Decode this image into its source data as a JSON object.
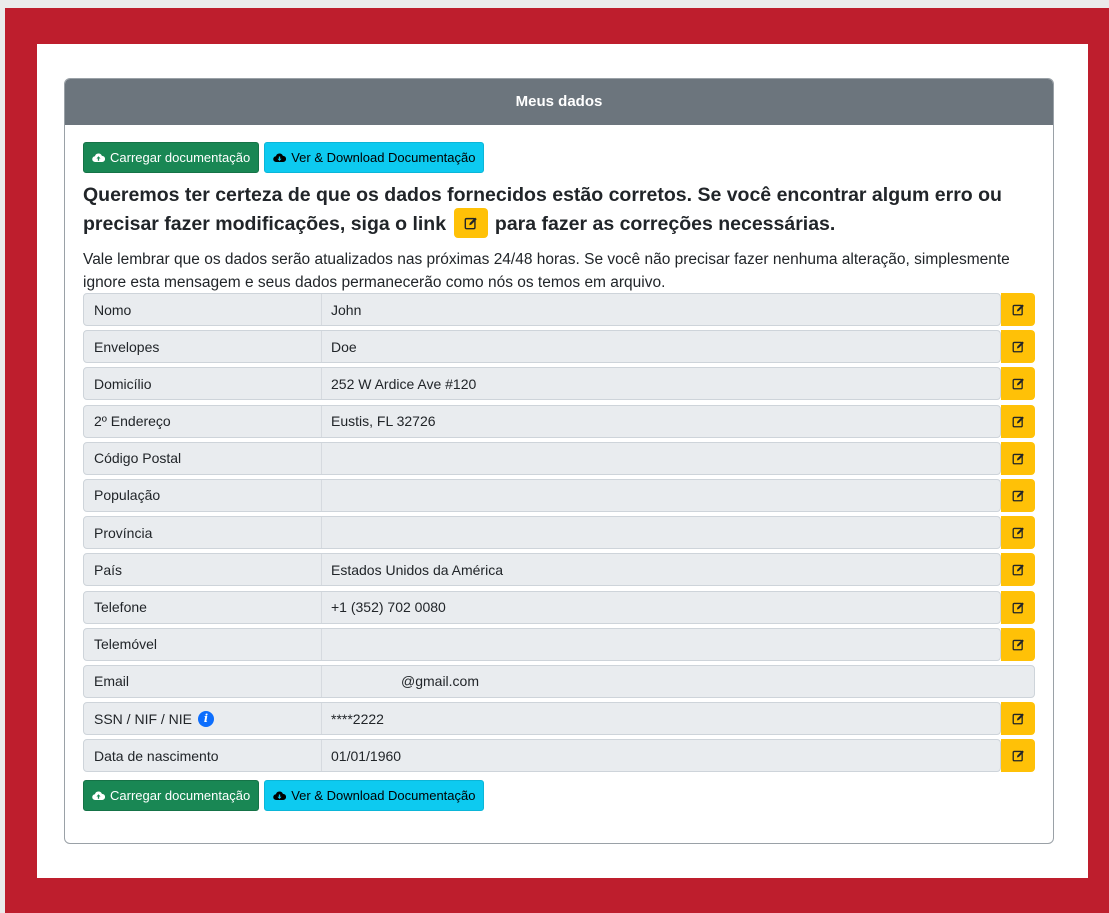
{
  "card": {
    "title": "Meus dados"
  },
  "buttons": {
    "upload_label": "Carregar documentação",
    "download_label": "Ver & Download Documentação"
  },
  "headline": {
    "before": "Queremos ter certeza de que os dados fornecidos estão corretos. Se você encontrar algum erro ou precisar fazer modificações, siga o link",
    "after": "para fazer as correções necessárias."
  },
  "notice": "Vale lembrar que os dados serão atualizados nas próximas 24/48 horas. Se você não precisar fazer nenhuma alteração, simplesmente ignore esta mensagem e seus dados permanecerão como nós os temos em arquivo.",
  "rows": [
    {
      "label": "Nomo",
      "value": "John"
    },
    {
      "label": "Envelopes",
      "value": "Doe"
    },
    {
      "label": "Domicílio",
      "value": "252 W Ardice Ave #120"
    },
    {
      "label": "2º Endereço",
      "value": "Eustis, FL 32726"
    },
    {
      "label": "Código Postal",
      "value": ""
    },
    {
      "label": "População",
      "value": ""
    },
    {
      "label": "Província",
      "value": ""
    },
    {
      "label": "País",
      "value": "Estados Unidos da América"
    },
    {
      "label": "Telefone",
      "value": "+1 (352) 702 0080"
    },
    {
      "label": "Telemóvel",
      "value": ""
    },
    {
      "label": "Email",
      "value": "@gmail.com"
    },
    {
      "label": "SSN / NIF / NIE",
      "value": "****2222"
    },
    {
      "label": "Data de nascimento",
      "value": "01/01/1960"
    }
  ],
  "icons": {
    "upload": "cloud-upload-icon",
    "download": "cloud-download-icon",
    "edit": "edit-icon",
    "info": "info-icon"
  },
  "colors": {
    "frame": "#be1e2d",
    "header": "#6c757d",
    "green": "#198754",
    "cyan": "#0dcaf0",
    "edit": "#ffc107",
    "info": "#0d6efd"
  }
}
